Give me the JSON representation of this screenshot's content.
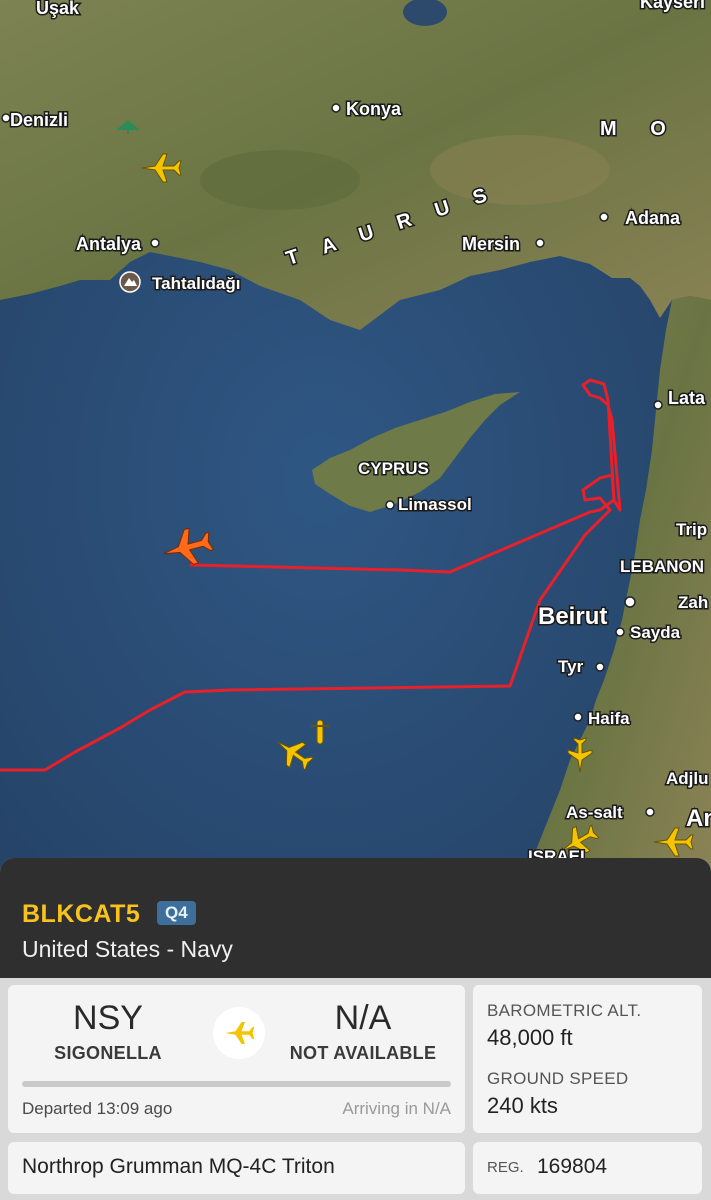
{
  "map": {
    "labels": {
      "usak": "Uşak",
      "kayseri": "Kayseri",
      "denizli": "Denizli",
      "konya": "Konya",
      "antalya": "Antalya",
      "tahtalidagi": "Tahtalıdağı",
      "taurus": "T A U R U S",
      "mersin": "Mersin",
      "adana": "Adana",
      "mo": "M O",
      "latakia": "Lata",
      "cyprus": "CYPRUS",
      "limassol": "Limassol",
      "tripoli": "Trip",
      "lebanon": "LEBANON",
      "beirut": "Beirut",
      "zahle": "Zah",
      "sayda": "Sayda",
      "tyr": "Tyr",
      "haifa": "Haifa",
      "ajloun": "Adjlu",
      "as_salt": "As-salt",
      "israel": "ISRAEL",
      "amman": "Am"
    },
    "colors": {
      "track": "#e8202a",
      "selected_aircraft": "#ff6a1a",
      "other_aircraft": "#f5c400",
      "sea": "#2a4b72",
      "land": "#6f7a45"
    }
  },
  "flight": {
    "callsign": "BLKCAT5",
    "type_code": "Q4",
    "operator": "United States - Navy",
    "origin": {
      "code": "NSY",
      "name": "SIGONELLA"
    },
    "destination": {
      "code": "N/A",
      "name": "NOT AVAILABLE"
    },
    "departed": "Departed 13:09 ago",
    "arriving": "Arriving in N/A",
    "aircraft_type": "Northrop Grumman MQ-4C Triton",
    "barometric_alt_label": "BAROMETRIC ALT.",
    "barometric_alt": "48,000 ft",
    "ground_speed_label": "GROUND SPEED",
    "ground_speed": "240 kts",
    "reg_label": "REG.",
    "registration": "169804"
  }
}
